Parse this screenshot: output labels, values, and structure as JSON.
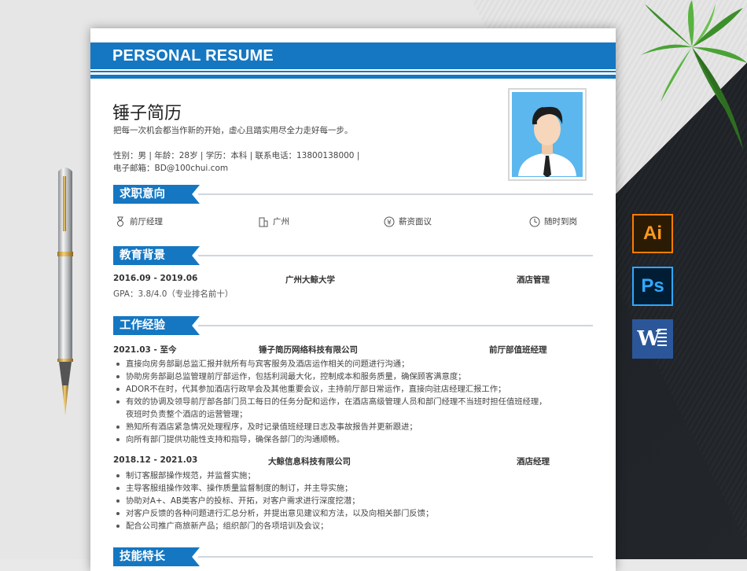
{
  "resume": {
    "banner_title": "PERSONAL RESUME",
    "name": "锤子简历",
    "motto": "把每一次机会都当作新的开始，虚心且踏实用尽全力走好每一步。",
    "info_line1": "性别：男 | 年龄：28岁 | 学历：本科 | 联系电话：13800138000 |",
    "info_line2": "电子邮箱：BD@100chui.com",
    "sections": {
      "intent": "求职意向",
      "education": "教育背景",
      "work": "工作经验",
      "skills": "技能特长"
    },
    "intent": {
      "position": "前厅经理",
      "city": "广州",
      "salary": "薪资面议",
      "availability": "随时到岗"
    },
    "education": {
      "period": "2016.09 - 2019.06",
      "school": "广州大鲸大学",
      "major": "酒店管理",
      "gpa": "GPA：3.8/4.0（专业排名前十）"
    },
    "work": [
      {
        "period": "2021.03 - 至今",
        "company": "锤子简历网络科技有限公司",
        "role": "前厅部值班经理",
        "duties": [
          "直接向房务部副总监汇报并就所有与宾客服务及酒店运作相关的问题进行沟通；",
          "协助房务部副总监管理前厅部运作，包括利润最大化，控制成本和服务质量，确保顾客满意度；",
          "ADOR不在时，代其参加酒店行政早会及其他重要会议，主持前厅部日常运作，直接向驻店经理汇报工作；",
          "有效的协调及领导前厅部各部门员工每日的任务分配和运作，在酒店高级管理人员和部门经理不当班时担任值班经理，",
          "夜班时负责整个酒店的运营管理；",
          "熟知所有酒店紧急情况处理程序，及时记录值班经理日志及事故报告并更新跟进；",
          "向所有部门提供功能性支持和指导，确保各部门的沟通顺畅。"
        ]
      },
      {
        "period": "2018.12 - 2021.03",
        "company": "大鲸信息科技有限公司",
        "role": "酒店经理",
        "duties": [
          "制订客服部操作规范，并监督实施；",
          "主导客服组操作效率、操作质量监督制度的制订，并主导实施；",
          "协助对A+、AB类客户的投标、开拓，对客户需求进行深度挖潜；",
          "对客户反馈的各种问题进行汇总分析，并提出意见建议和方法，以及向相关部门反馈；",
          "配合公司推广商旅新产品；组织部门的各项培训及会议；"
        ]
      }
    ]
  },
  "apps": {
    "illustrator": "Ai",
    "photoshop": "Ps",
    "word": "W"
  },
  "colors": {
    "accent": "#1577c2",
    "ai_orange": "#ff7c00",
    "ps_blue": "#31a8ff",
    "word_blue": "#2b579a"
  }
}
